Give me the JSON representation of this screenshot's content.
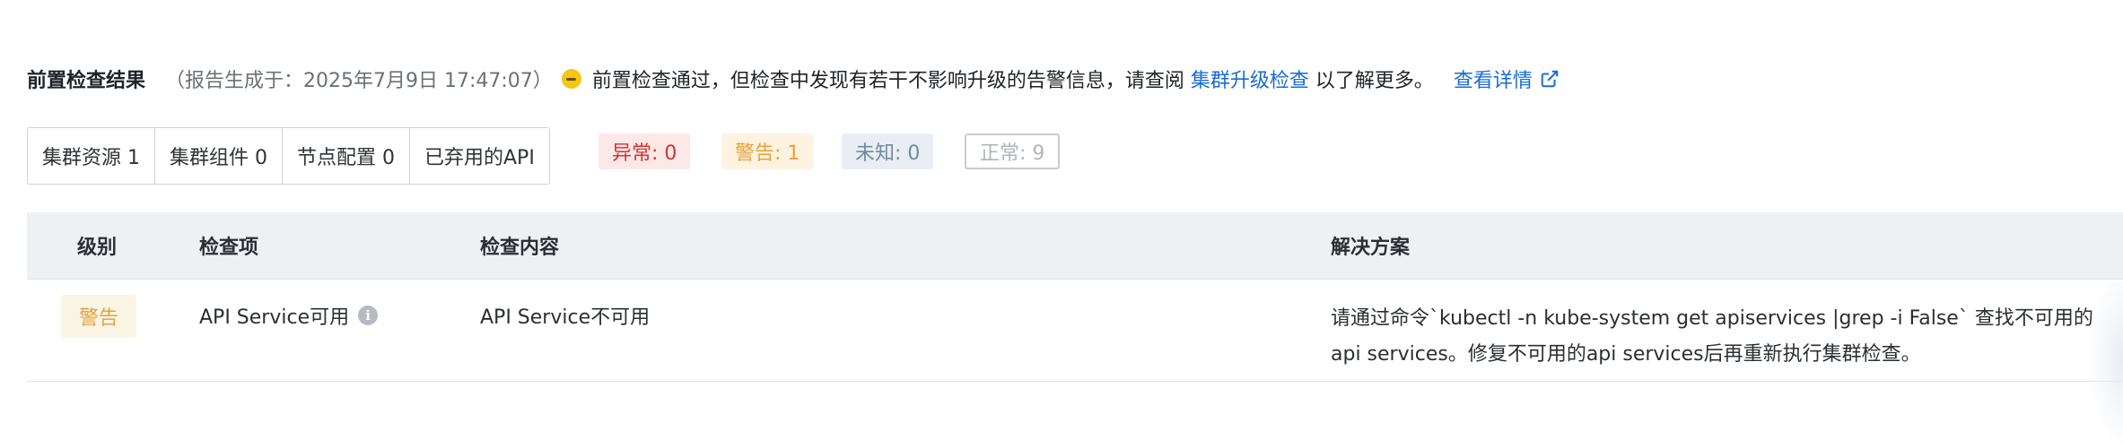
{
  "header": {
    "title": "前置检查结果",
    "generated_at": "（报告生成于：2025年7月9日 17:47:07）",
    "message_prefix": "前置检查通过，但检查中发现有若干不影响升级的告警信息，请查阅 ",
    "message_link": "集群升级检查",
    "message_suffix": " 以了解更多。",
    "detail_link": "查看详情",
    "status_icon": "warning-dot-icon"
  },
  "category_tabs": [
    {
      "label": "集群资源 1"
    },
    {
      "label": "集群组件 0"
    },
    {
      "label": "节点配置 0"
    },
    {
      "label": "已弃用的API"
    }
  ],
  "status_filters": {
    "abnormal": "异常: 0",
    "warning": "警告: 1",
    "unknown": "未知: 0",
    "normal": "正常: 9"
  },
  "table": {
    "columns": {
      "level": "级别",
      "item": "检查项",
      "content": "检查内容",
      "solution": "解决方案"
    },
    "rows": [
      {
        "level": "警告",
        "item": "API Service可用",
        "content": "API Service不可用",
        "solution": "请通过命令`kubectl -n kube-system get apiservices |grep -i False` 查找不可用的api services。修复不可用的api services后再重新执行集群检查。"
      }
    ]
  },
  "colors": {
    "link": "#1a6cd6",
    "warning": "#e6a23c",
    "abnormal": "#d4322f",
    "unknown": "#6f8aa3"
  }
}
